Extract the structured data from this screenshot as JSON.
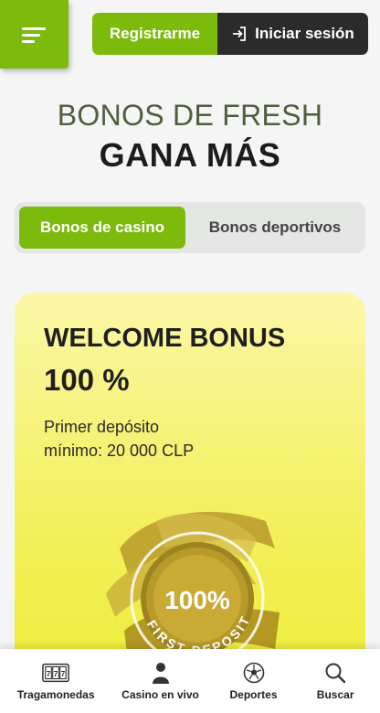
{
  "header": {
    "menu_icon": "hamburger-icon",
    "register_label": "Registrarme",
    "login_label": "Iniciar sesión",
    "login_icon": "login-arrow-icon"
  },
  "hero": {
    "line1": "BONOS DE FRESH",
    "line2": "GANA MÁS"
  },
  "tabs": [
    {
      "label": "Bonos de casino",
      "active": true
    },
    {
      "label": "Bonos deportivos",
      "active": false
    }
  ],
  "bonus_card": {
    "title": "WELCOME BONUS",
    "value": "100 %",
    "desc_line1": "Primer depósito",
    "desc_line2": "mínimo: 20 000 CLP",
    "badge_percent": "100%",
    "badge_text": "FIRST DEPOSIT"
  },
  "bottom_nav": [
    {
      "label": "Tragamonedas",
      "icon": "slot-machine-icon"
    },
    {
      "label": "Casino en vivo",
      "icon": "dealer-icon"
    },
    {
      "label": "Deportes",
      "icon": "soccer-ball-icon"
    },
    {
      "label": "Buscar",
      "icon": "search-icon"
    }
  ],
  "colors": {
    "brand_green": "#7cbb0c",
    "dark": "#2b2b2b",
    "card_yellow": "#f4f062"
  }
}
